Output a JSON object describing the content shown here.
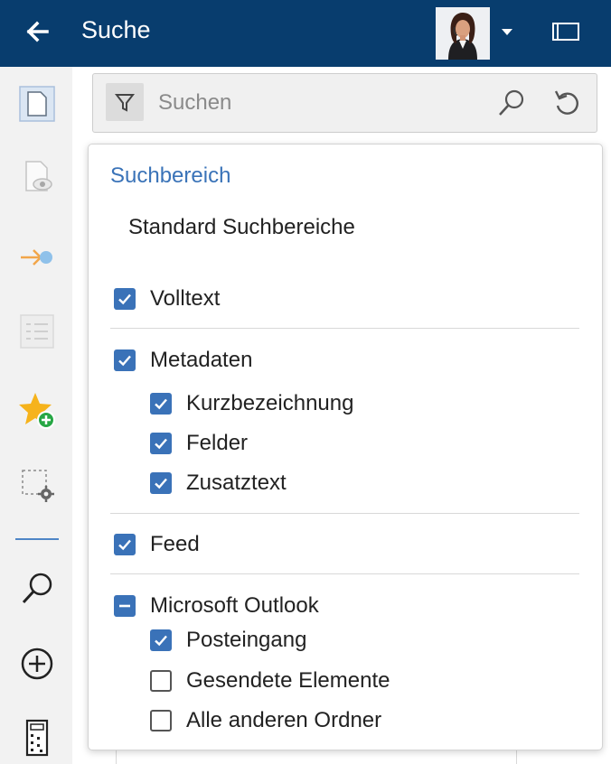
{
  "header": {
    "title": "Suche",
    "back_icon": "arrow-left-icon",
    "user_avatar": "user-avatar",
    "menu_icon": "caret-down-icon",
    "window_icon": "window-icon",
    "background": "#083d6e"
  },
  "rail": {
    "items": [
      {
        "name": "document-icon"
      },
      {
        "name": "document-preview-icon"
      },
      {
        "name": "arrow-target-icon"
      },
      {
        "name": "list-icon"
      },
      {
        "name": "star-add-icon"
      },
      {
        "name": "selection-settings-icon"
      },
      {
        "name": "search-icon"
      },
      {
        "name": "add-circle-icon"
      },
      {
        "name": "calculator-icon"
      }
    ]
  },
  "search": {
    "placeholder": "Suchen",
    "value": "",
    "filter_icon": "filter-icon",
    "search_icon": "search-icon",
    "reset_icon": "reset-icon"
  },
  "scope_popup": {
    "title": "Suchbereich",
    "preset": "Standard Suchbereiche",
    "items": [
      {
        "label": "Volltext",
        "state": "checked"
      },
      {
        "label": "Metadaten",
        "state": "checked"
      },
      {
        "label": "Kurzbezeichnung",
        "state": "checked"
      },
      {
        "label": "Felder",
        "state": "checked"
      },
      {
        "label": "Zusatztext",
        "state": "checked"
      },
      {
        "label": "Feed",
        "state": "checked"
      },
      {
        "label": "Microsoft Outlook",
        "state": "indeterminate"
      },
      {
        "label": "Posteingang",
        "state": "checked"
      },
      {
        "label": "Gesendete Elemente",
        "state": "unchecked"
      },
      {
        "label": "Alle anderen Ordner",
        "state": "unchecked"
      }
    ]
  },
  "colors": {
    "accent": "#3a72b8",
    "title_blue": "#3a73b8",
    "rail_bg": "#f2f2f2"
  }
}
